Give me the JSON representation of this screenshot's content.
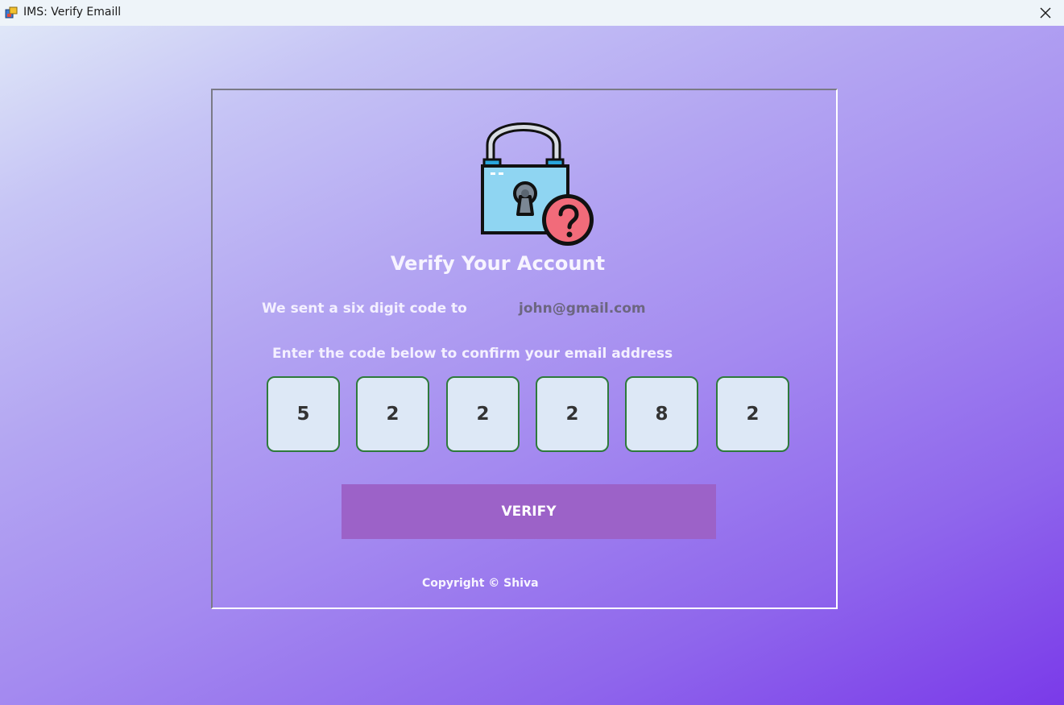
{
  "window": {
    "title": "IMS: Verify Emaill"
  },
  "main": {
    "heading": "Verify Your Account",
    "sent_text": "We sent a six digit code to",
    "email": "john@gmail.com",
    "instruction": "Enter the code below to confirm your email address",
    "code_digits": [
      "5",
      "2",
      "2",
      "2",
      "8",
      "2"
    ],
    "verify_label": "VERIFY",
    "copyright": "Copyright © Shiva"
  },
  "icons": {
    "app": "app-icon",
    "close": "close-icon",
    "lock": "lock-question-icon"
  },
  "colors": {
    "button": "#9c62c8",
    "digit_border": "#2e7a3b",
    "digit_fill": "#dde8f6",
    "email_text": "#6c6680"
  }
}
